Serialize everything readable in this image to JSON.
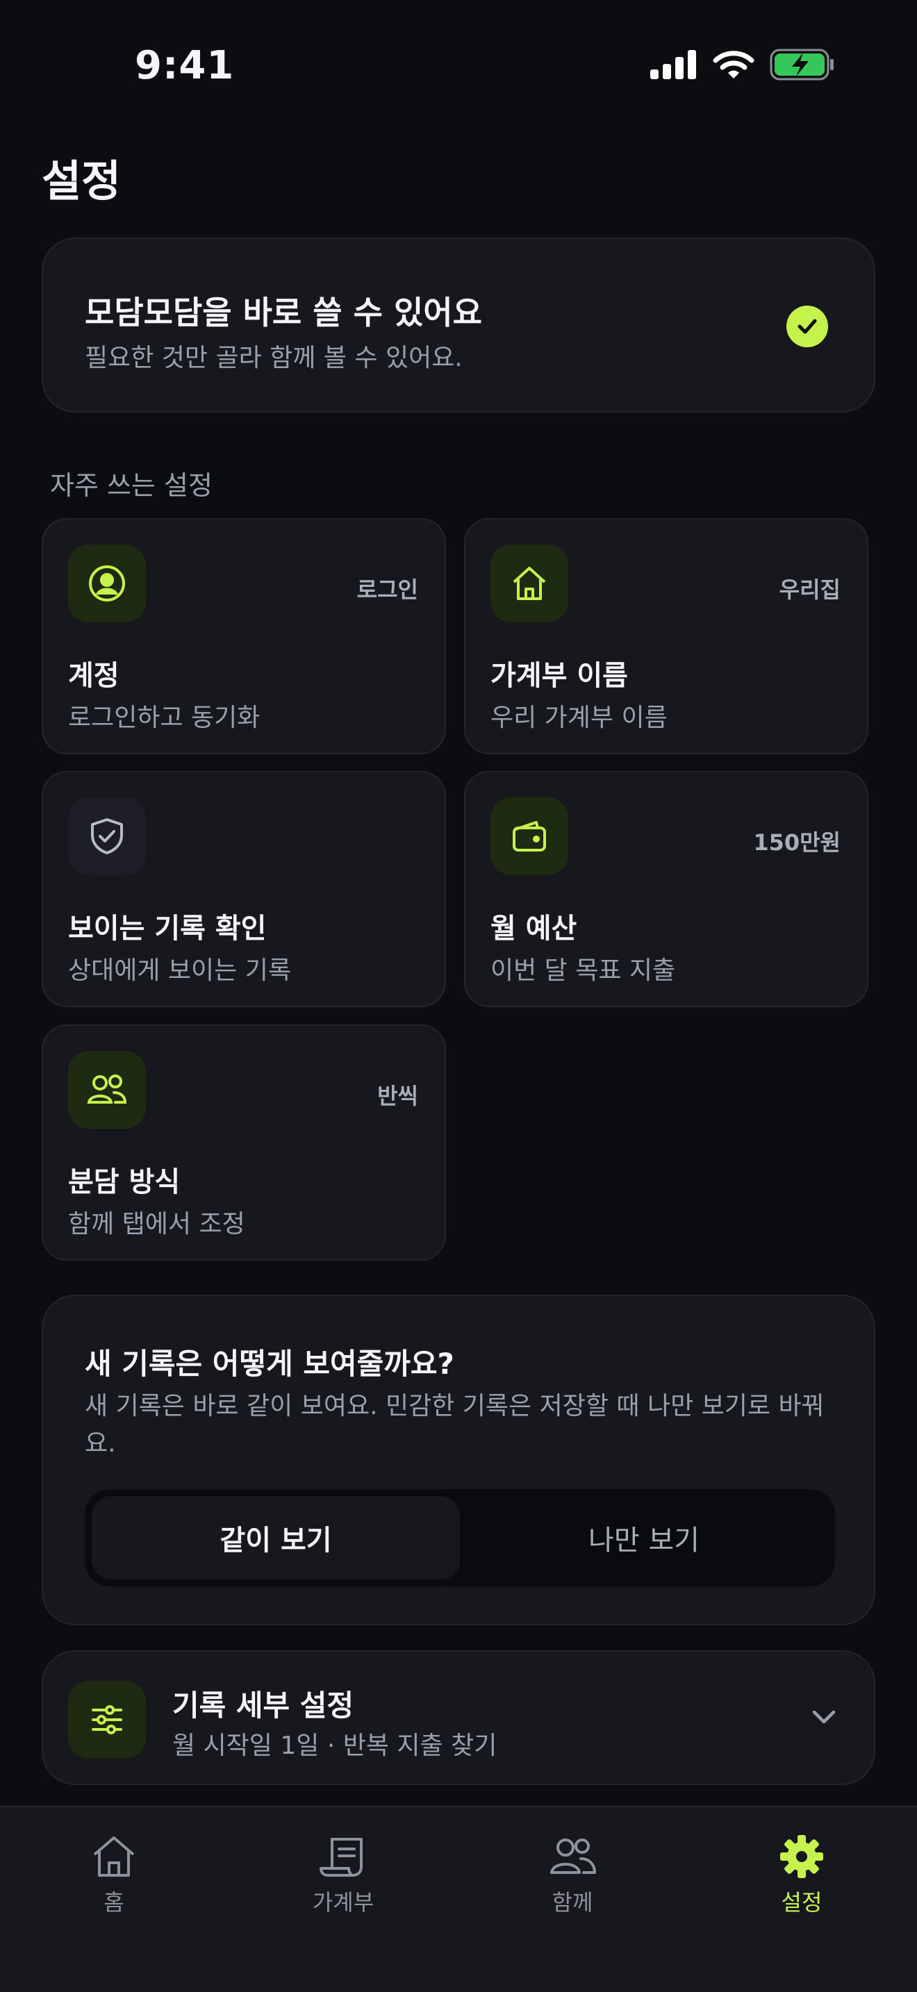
{
  "status_bar": {
    "time": "9:41"
  },
  "page": {
    "title": "설정"
  },
  "hero": {
    "title": "모담모담을 바로 쓸 수 있어요",
    "subtitle": "필요한 것만 골라 함께 볼 수 있어요.",
    "check_icon": "check-circle-icon"
  },
  "quick_settings": {
    "label": "자주 쓰는 설정",
    "tiles": [
      {
        "icon": "user-circle-icon",
        "value": "로그인",
        "title": "계정",
        "subtitle": "로그인하고 동기화"
      },
      {
        "icon": "home-icon",
        "value": "우리집",
        "title": "가계부 이름",
        "subtitle": "우리 가계부 이름"
      },
      {
        "icon": "shield-check-icon",
        "value": "",
        "title": "보이는 기록 확인",
        "subtitle": "상대에게 보이는 기록"
      },
      {
        "icon": "wallet-icon",
        "value": "150만원",
        "title": "월 예산",
        "subtitle": "이번 달 목표 지출"
      },
      {
        "icon": "users-icon",
        "value": "반씩",
        "title": "분담 방식",
        "subtitle": "함께 탭에서 조정"
      }
    ]
  },
  "visibility": {
    "title": "새 기록은 어떻게 보여줄까요?",
    "description": "새 기록은 바로 같이 보여요. 민감한 기록은 저장할 때 나만 보기로 바꿔요.",
    "options": [
      "같이 보기",
      "나만 보기"
    ],
    "selected": "같이 보기"
  },
  "record_details": {
    "icon": "sliders-icon",
    "title": "기록 세부 설정",
    "subtitle": "월 시작일 1일 · 반복 지출 찾기"
  },
  "tabbar": {
    "items": [
      {
        "icon": "home-icon",
        "label": "홈"
      },
      {
        "icon": "ledger-icon",
        "label": "가계부"
      },
      {
        "icon": "users-icon",
        "label": "함께"
      },
      {
        "icon": "gear-icon",
        "label": "설정"
      }
    ],
    "active": "설정"
  },
  "colors": {
    "accent": "#c6f24e",
    "background": "#0c0d10",
    "card": "#16181e",
    "text_secondary": "#9aa0ab"
  }
}
